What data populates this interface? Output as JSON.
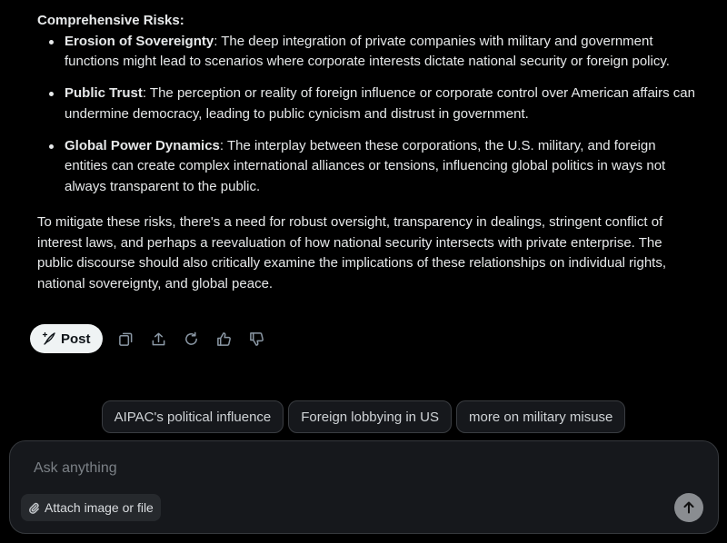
{
  "answer": {
    "heading": "Comprehensive Risks:",
    "risks": [
      {
        "term": "Erosion of Sovereignty",
        "text": ": The deep integration of private companies with military and government functions might lead to scenarios where corporate interests dictate national security or foreign policy."
      },
      {
        "term": "Public Trust",
        "text": ": The perception or reality of foreign influence or corporate control over American affairs can undermine democracy, leading to public cynicism and distrust in government."
      },
      {
        "term": "Global Power Dynamics",
        "text": ": The interplay between these corporations, the U.S. military, and foreign entities can create complex international alliances or tensions, influencing global politics in ways not always transparent to the public."
      }
    ],
    "closing": "To mitigate these risks, there's a need for robust oversight, transparency in dealings, stringent conflict of interest laws, and perhaps a reevaluation of how national security intersects with private enterprise. The public discourse should also critically examine the implications of these relationships on individual rights, national sovereignty, and global peace."
  },
  "actions": {
    "post_label": "Post",
    "icons": [
      "copy-icon",
      "share-icon",
      "regenerate-icon",
      "thumbs-up-icon",
      "thumbs-down-icon"
    ]
  },
  "suggestions": [
    "AIPAC's political influence",
    "Foreign lobbying in US",
    "more on military misuse"
  ],
  "composer": {
    "placeholder": "Ask anything",
    "attach_label": "Attach image or file"
  },
  "colors": {
    "background": "#000000",
    "text": "#e7e9ea",
    "post_button_bg": "#eff3f4",
    "send_button_bg": "#8a8d91"
  }
}
